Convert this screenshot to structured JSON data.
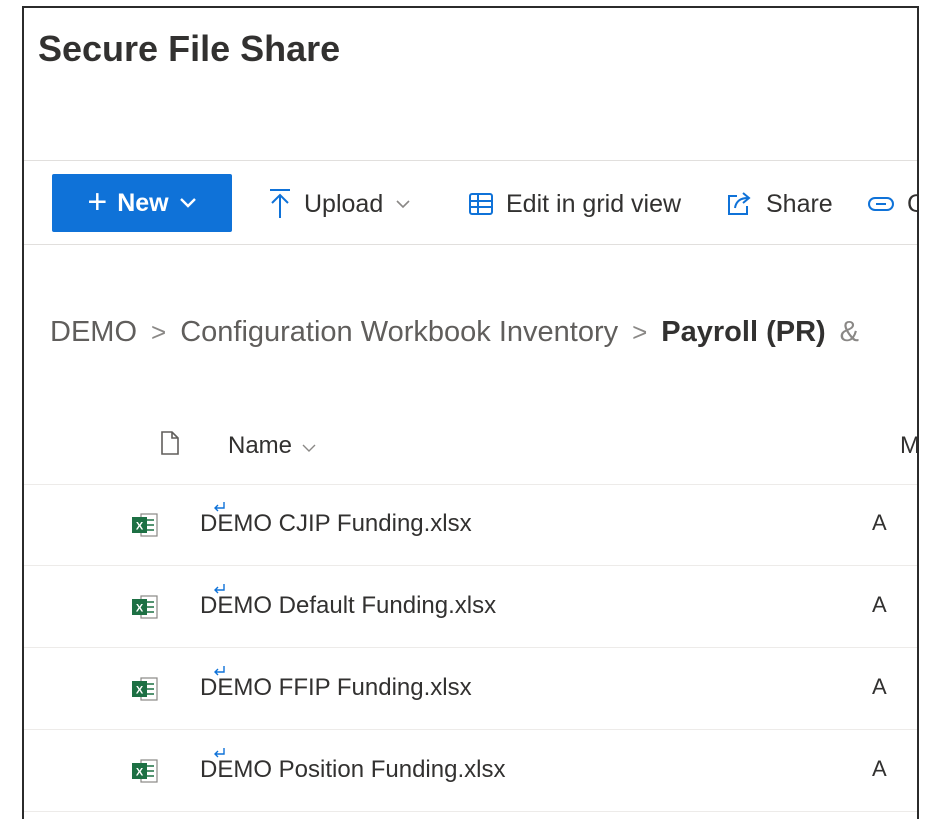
{
  "app": {
    "title": "Secure File Share"
  },
  "toolbar": {
    "new_label": "New",
    "upload_label": "Upload",
    "grid_label": "Edit in grid view",
    "share_label": "Share",
    "copy_label_partial": "C"
  },
  "breadcrumb": {
    "items": [
      "DEMO",
      "Configuration Workbook Inventory"
    ],
    "current": "Payroll (PR)",
    "overflow": "&"
  },
  "list": {
    "columns": {
      "name": "Name",
      "modified": "M"
    },
    "files": [
      {
        "name": "DEMO CJIP Funding.xlsx",
        "modified": "A"
      },
      {
        "name": "DEMO Default Funding.xlsx",
        "modified": "A"
      },
      {
        "name": "DEMO FFIP Funding.xlsx",
        "modified": "A"
      },
      {
        "name": "DEMO Position Funding.xlsx",
        "modified": "A"
      }
    ]
  },
  "icons": {
    "new": "plus-icon",
    "upload": "upload-icon",
    "grid": "grid-icon",
    "share": "share-icon",
    "link": "link-icon",
    "file_type": "excel-icon"
  },
  "colors": {
    "accent": "#0f72d8",
    "excel": "#1d7044"
  }
}
